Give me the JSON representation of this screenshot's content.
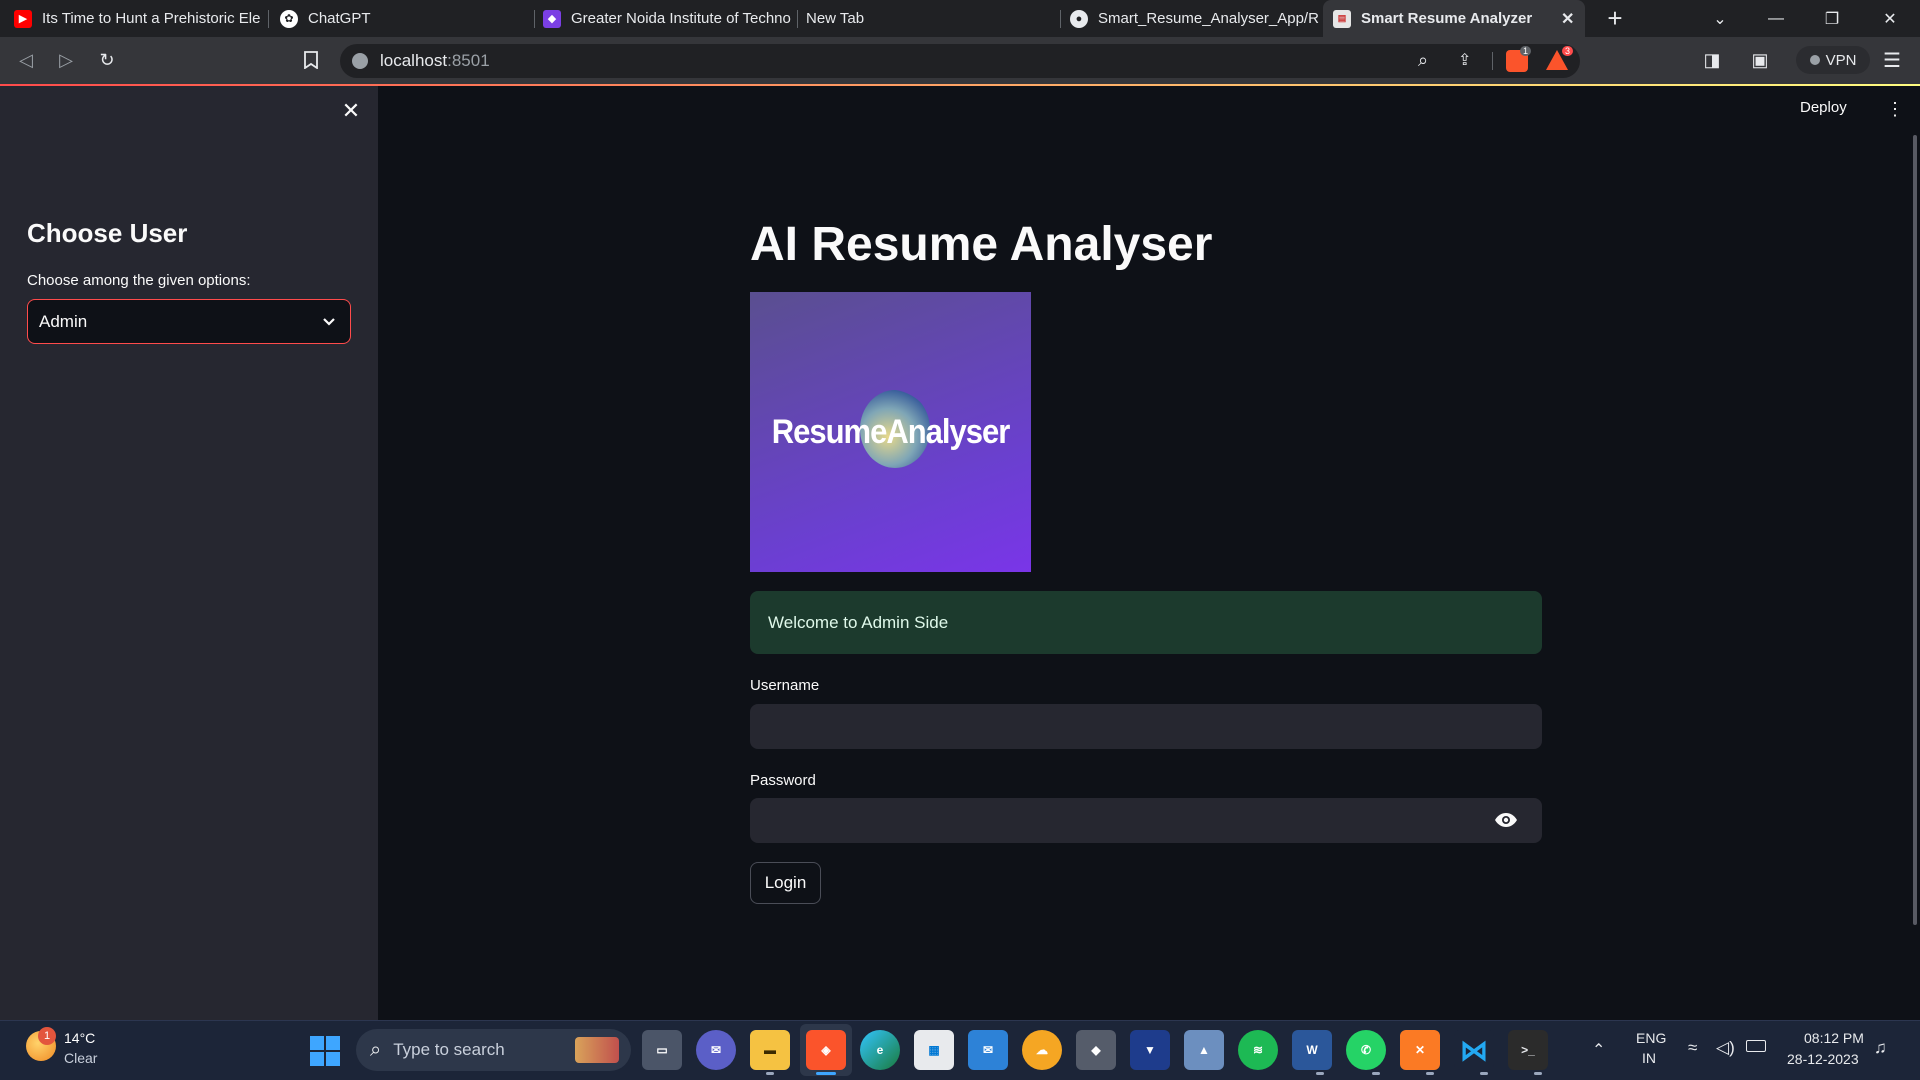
{
  "browser": {
    "tabs": [
      {
        "title": "Its Time to Hunt a Prehistoric Ele",
        "icon": "youtube-icon"
      },
      {
        "title": "ChatGPT",
        "icon": "chatgpt-icon"
      },
      {
        "title": "Greater Noida Institute of Techno",
        "icon": "site-icon"
      },
      {
        "title": "New Tab",
        "icon": ""
      },
      {
        "title": "Smart_Resume_Analyser_App/RE",
        "icon": "github-icon"
      },
      {
        "title": "Smart Resume Analyzer",
        "icon": "streamlit-icon"
      }
    ],
    "url_host": "localhost",
    "url_port": ":8501",
    "shield_badge": "1",
    "alert_badge": "3",
    "vpn_label": "VPN"
  },
  "sidebar": {
    "title": "Choose User",
    "select_label": "Choose among the given options:",
    "selected_value": "Admin"
  },
  "main": {
    "deploy_label": "Deploy",
    "title": "AI Resume Analyser",
    "logo_text": "ResumeAnalyser",
    "welcome_message": "Welcome to Admin Side",
    "username_label": "Username",
    "username_value": "",
    "password_label": "Password",
    "password_value": "",
    "login_label": "Login"
  },
  "taskbar": {
    "weather_temp": "14°C",
    "weather_desc": "Clear",
    "weather_badge": "1",
    "search_placeholder": "Type to search",
    "lang_top": "ENG",
    "lang_bottom": "IN",
    "time": "08:12 PM",
    "date": "28-12-2023"
  },
  "colors": {
    "accent": "#ff4b4b",
    "background": "#0e1117",
    "sidebar": "#262730",
    "success_bg": "#1c3a2d"
  }
}
